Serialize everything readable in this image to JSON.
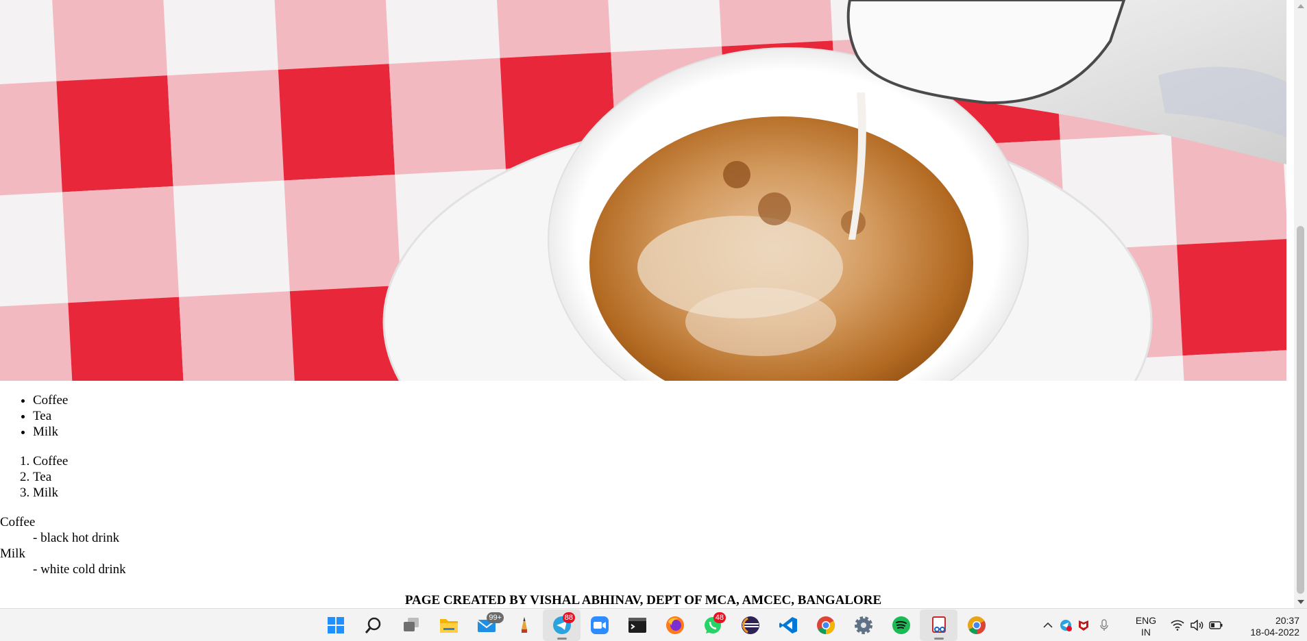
{
  "page": {
    "unordered_list": [
      "Coffee",
      "Tea",
      "Milk"
    ],
    "ordered_list": [
      "Coffee",
      "Tea",
      "Milk"
    ],
    "definitions": [
      {
        "term": "Coffee",
        "desc": "- black hot drink"
      },
      {
        "term": "Milk",
        "desc": "- white cold drink"
      }
    ],
    "footer": "PAGE CREATED BY VISHAL ABHINAV, DEPT OF MCA, AMCEC, BANGALORE"
  },
  "taskbar": {
    "apps": [
      {
        "icon": "windows-start-icon"
      },
      {
        "icon": "search-icon"
      },
      {
        "icon": "task-view-icon"
      },
      {
        "icon": "file-explorer-icon"
      },
      {
        "icon": "mail-icon",
        "badge": "99+"
      },
      {
        "icon": "pencil-icon"
      },
      {
        "icon": "telegram-icon",
        "badge": "88"
      },
      {
        "icon": "zoom-icon"
      },
      {
        "icon": "terminal-icon"
      },
      {
        "icon": "firefox-icon"
      },
      {
        "icon": "whatsapp-icon",
        "badge": "48"
      },
      {
        "icon": "eclipse-icon"
      },
      {
        "icon": "vscode-icon"
      },
      {
        "icon": "chrome-icon"
      },
      {
        "icon": "settings-icon"
      },
      {
        "icon": "spotify-icon"
      },
      {
        "icon": "snipping-tool-icon"
      },
      {
        "icon": "chrome-canary-icon"
      }
    ],
    "tray": {
      "language_line1": "ENG",
      "language_line2": "IN",
      "time": "20:37",
      "date": "18-04-2022"
    }
  },
  "colors": {
    "checker_red": "#e8283a",
    "checker_pink": "#f3b9c0",
    "tea": "#b5722f",
    "taskbar_bg": "#f3f3f3"
  }
}
